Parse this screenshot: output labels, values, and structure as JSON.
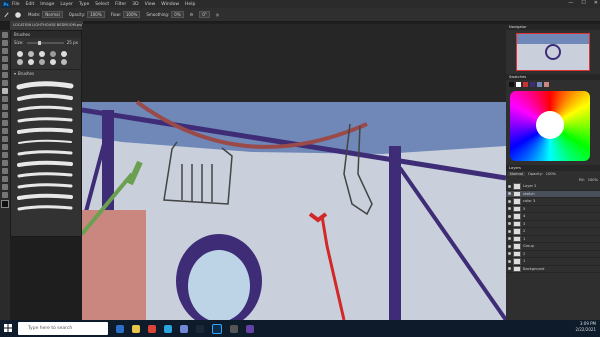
{
  "menu": {
    "items": [
      "File",
      "Edit",
      "Image",
      "Layer",
      "Type",
      "Select",
      "Filter",
      "3D",
      "View",
      "Window",
      "Help"
    ],
    "window_controls": [
      "—",
      "☐",
      "✕"
    ]
  },
  "options": {
    "mode_label": "Mode:",
    "mode_value": "Normal",
    "opacity_label": "Opacity:",
    "opacity_value": "100%",
    "flow_label": "Flow:",
    "flow_value": "100%",
    "smoothing_label": "Smoothing:",
    "smoothing_value": "0%",
    "angle_value": "0°"
  },
  "document": {
    "tab_title": "LOCATION LIGHTHOUSE BEDROOM.psd @ 100% (sketch, RGB/8)"
  },
  "brushes": {
    "title": "Brushes",
    "size_label": "Size:",
    "size_value": "25 px",
    "folder": "Brushes"
  },
  "navigator": {
    "title": "Navigator"
  },
  "color": {
    "title": "Swatches"
  },
  "layers": {
    "title": "Layers",
    "blend": "Normal",
    "opacity_label": "Opacity:",
    "opacity_value": "100%",
    "fill_label": "Fill:",
    "fill_value": "100%",
    "rows": [
      "Layer 2",
      "sketch",
      "color 3",
      "5",
      "4",
      "3",
      "2",
      "1",
      "Group",
      "2",
      "1",
      "Background"
    ]
  },
  "taskbar": {
    "search_placeholder": "Type here to search",
    "time": "3:09 PM",
    "date": "2/22/2021"
  },
  "colors": {
    "wall": "#c9d0dc",
    "ceiling": "#6f88b8",
    "beam": "#3e2c77",
    "porthole": "#3e2c77",
    "flag": "#c9877f",
    "rope": "#d22828",
    "accent": "#31a8ff"
  }
}
